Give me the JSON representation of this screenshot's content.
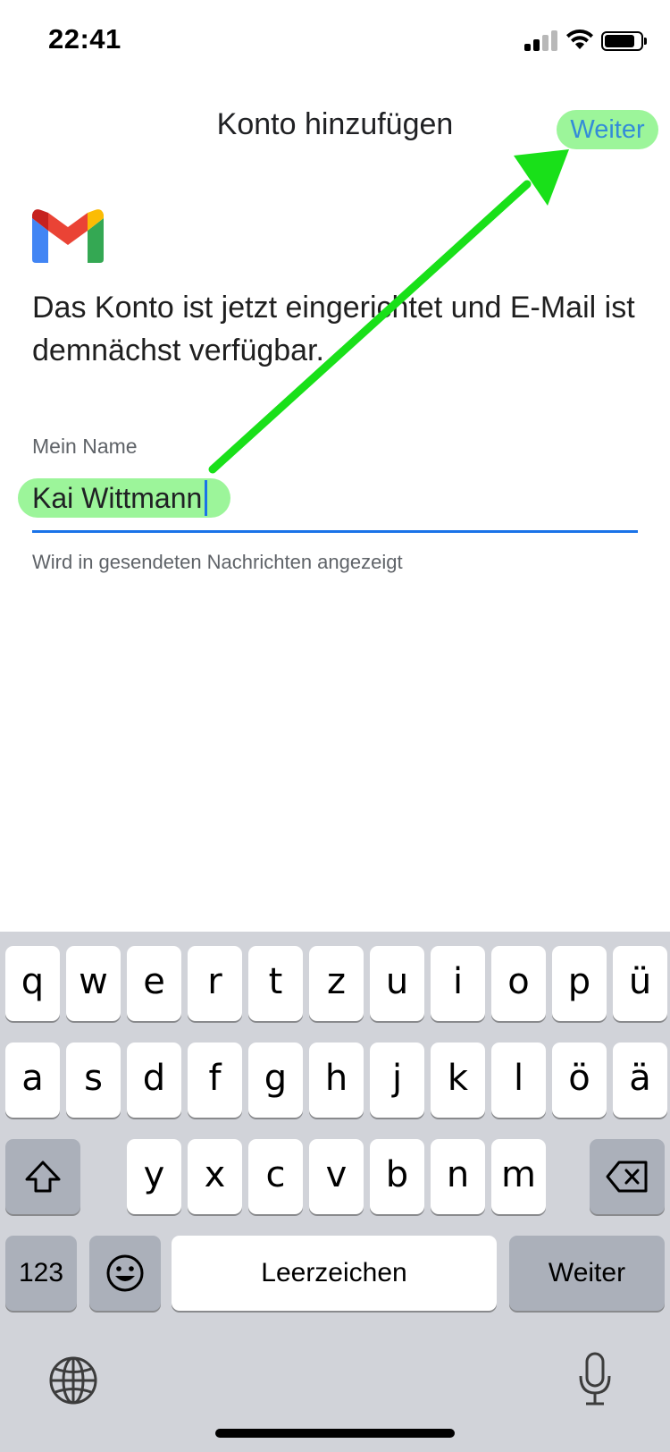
{
  "status_bar": {
    "time": "22:41"
  },
  "header": {
    "title": "Konto hinzufügen",
    "next_label": "Weiter"
  },
  "content": {
    "message": "Das Konto ist jetzt eingerichtet und E-Mail ist demnächst verfügbar.",
    "name_field": {
      "label": "Mein Name",
      "value": "Kai Wittmann",
      "helper": "Wird in gesendeten Nachrichten angezeigt"
    }
  },
  "keyboard": {
    "row1": [
      "q",
      "w",
      "e",
      "r",
      "t",
      "z",
      "u",
      "i",
      "o",
      "p",
      "ü"
    ],
    "row2": [
      "a",
      "s",
      "d",
      "f",
      "g",
      "h",
      "j",
      "k",
      "l",
      "ö",
      "ä"
    ],
    "row3": [
      "y",
      "x",
      "c",
      "v",
      "b",
      "n",
      "m"
    ],
    "numbers_label": "123",
    "space_label": "Leerzeichen",
    "return_label": "Weiter"
  },
  "colors": {
    "accent": "#1a73e8",
    "highlight": "#9cf59a",
    "annotation_arrow": "#19e019",
    "keyboard_bg": "#d1d3d9"
  }
}
